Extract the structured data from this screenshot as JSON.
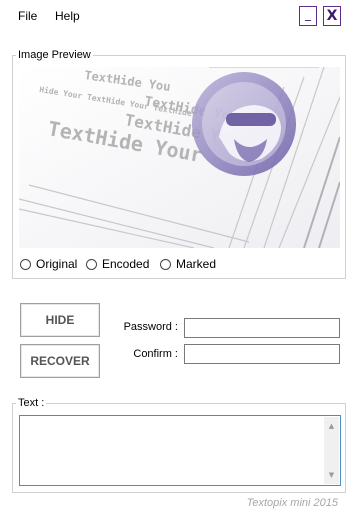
{
  "menu": {
    "file": "File",
    "help": "Help"
  },
  "window": {
    "minimize_label": "_",
    "close_label": "X"
  },
  "preview_group": {
    "legend": "Image Preview",
    "watermark_text": [
      "TextHide You",
      "TextHide Your",
      "Hide Your TextHide Your TextHide",
      "TextHide Your",
      "TextHide Your"
    ]
  },
  "view_modes": [
    "Original",
    "Encoded",
    "Marked"
  ],
  "buttons": {
    "hide": "HIDE",
    "recover": "RECOVER"
  },
  "password": {
    "label": "Password :",
    "value": ""
  },
  "confirm": {
    "label": "Confirm :",
    "value": ""
  },
  "text_group": {
    "legend": "Text :",
    "value": ""
  },
  "footer": "Textopix mini 2015",
  "colors": {
    "accent": "#5b2c8c",
    "logo": "#7c6cb0",
    "focus_border": "#4a8cc4"
  },
  "icons": {
    "scroll_up": "up-arrow-icon",
    "scroll_down": "down-arrow-icon"
  }
}
